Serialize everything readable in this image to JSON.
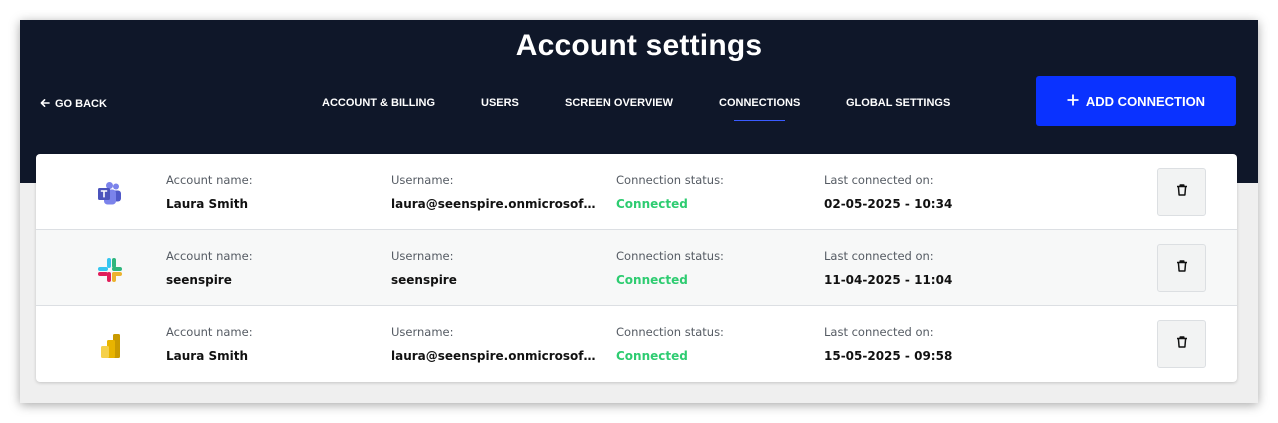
{
  "header": {
    "title": "Account settings",
    "go_back": "GO BACK",
    "add_connection": "ADD CONNECTION"
  },
  "nav": {
    "tabs": [
      {
        "label": "ACCOUNT & BILLING",
        "active": false
      },
      {
        "label": "USERS",
        "active": false
      },
      {
        "label": "SCREEN OVERVIEW",
        "active": false
      },
      {
        "label": "CONNECTIONS",
        "active": true
      },
      {
        "label": "GLOBAL SETTINGS",
        "active": false
      }
    ]
  },
  "labels": {
    "account_name": "Account name:",
    "username": "Username:",
    "status": "Connection status:",
    "last_connected": "Last connected on:"
  },
  "connections": [
    {
      "icon": "microsoft-teams-icon",
      "account_name": "Laura Smith",
      "username": "laura@seenspire.onmicrosof…",
      "status": "Connected",
      "last_connected": "02-05-2025 - 10:34"
    },
    {
      "icon": "slack-icon",
      "account_name": "seenspire",
      "username": "seenspire",
      "status": "Connected",
      "last_connected": "11-04-2025 - 11:04"
    },
    {
      "icon": "power-bi-icon",
      "account_name": "Laura Smith",
      "username": "laura@seenspire.onmicrosof…",
      "status": "Connected",
      "last_connected": "15-05-2025 - 09:58"
    }
  ],
  "colors": {
    "header_bg": "#0f1729",
    "accent": "#0a32ff",
    "status_ok": "#2ecc71"
  }
}
